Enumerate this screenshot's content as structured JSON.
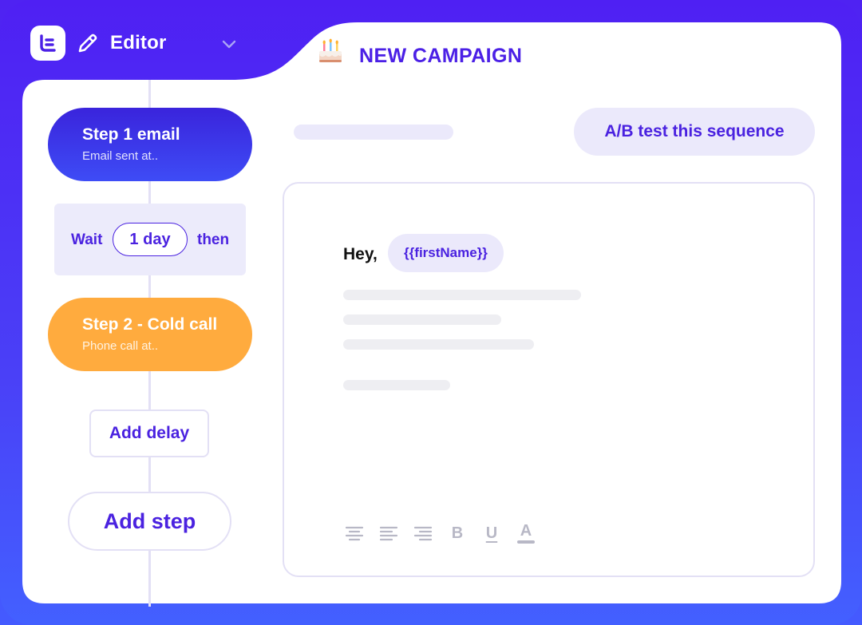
{
  "header": {
    "logo_icon": "logo-icon",
    "mode_label": "Editor",
    "mode_icon": "pencil-icon",
    "dropdown_icon": "chevron-down-icon",
    "campaign_emoji_icon": "birthday-cake-icon",
    "campaign_title": "NEW CAMPAIGN"
  },
  "sequence": {
    "step1": {
      "title": "Step 1 email",
      "subtitle": "Email sent at.."
    },
    "wait": {
      "prefix": "Wait",
      "value": "1 day",
      "suffix": "then"
    },
    "step2": {
      "title": "Step 2 - Cold call",
      "subtitle": "Phone call at.."
    },
    "add_delay_label": "Add delay",
    "add_step_label": "Add step"
  },
  "editor": {
    "ab_test_label": "A/B test this sequence",
    "greeting": "Hey,",
    "variable": "{{firstName}}",
    "toolbar": {
      "align_left_icon": "align-left-icon",
      "align_center_icon": "align-center-icon",
      "align_right_icon": "align-right-icon",
      "bold": "B",
      "underline": "U",
      "text_color": "A"
    }
  },
  "colors": {
    "brand_primary": "#4a22e0",
    "background_gradient_top": "#4f20f3",
    "background_gradient_bottom": "#4360ff",
    "step2_orange": "#ffab3e",
    "chip_bg": "#ebe9fb"
  }
}
